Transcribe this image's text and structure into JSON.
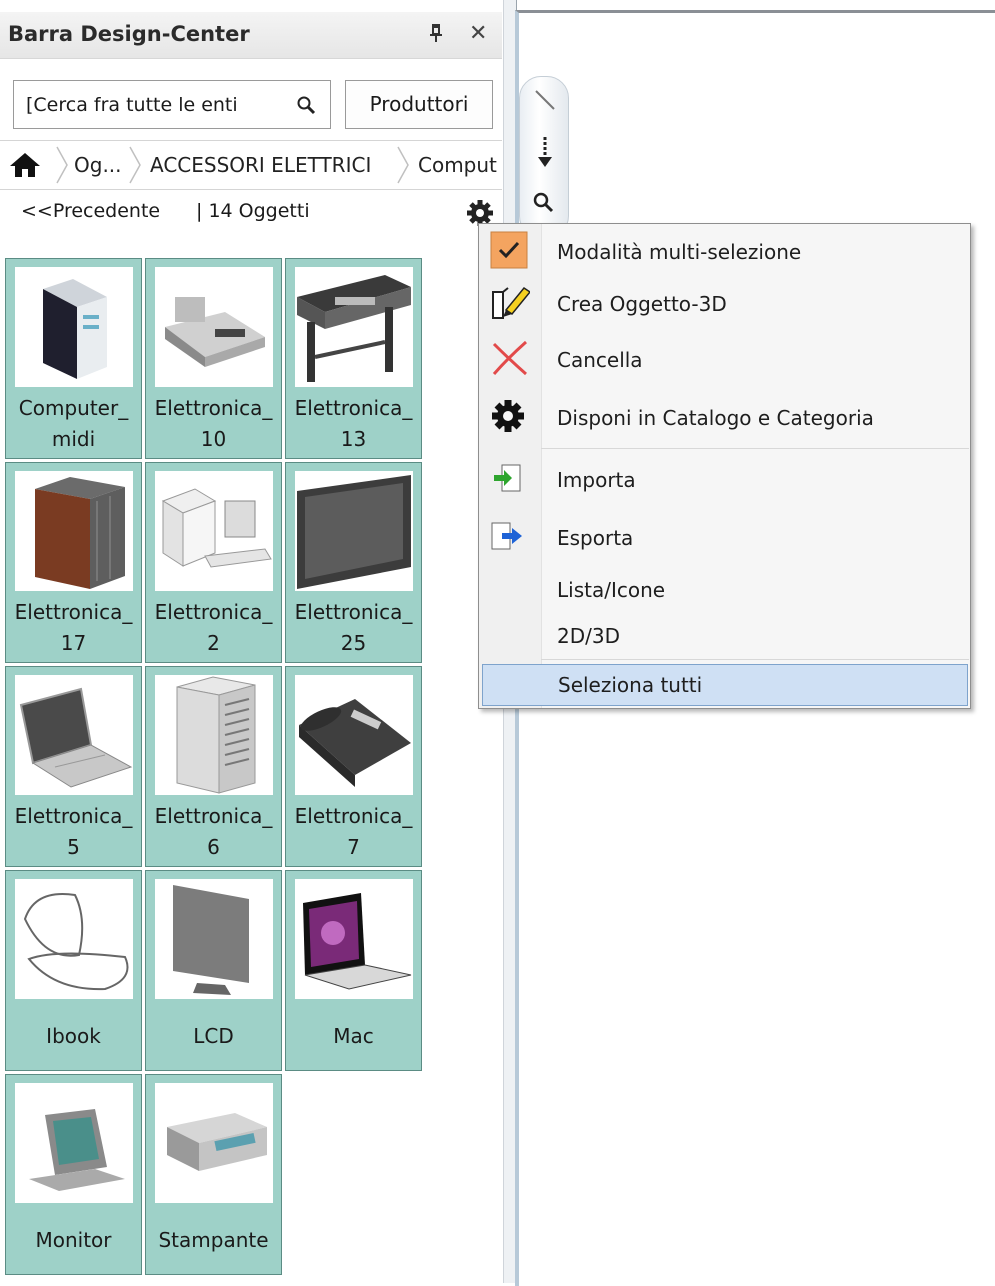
{
  "panel": {
    "title": "Barra Design-Center",
    "pin_icon": "pin-icon",
    "close_icon": "close-icon",
    "search": {
      "value": "[Cerca fra tutte le enti",
      "icon": "search-icon"
    },
    "produttori_label": "Produttori",
    "breadcrumb": [
      "Og...",
      "ACCESSORI ELETTRICI",
      "Comput"
    ],
    "nav": {
      "prev_label": "<<Precedente",
      "count_label": "| 14 Oggetti"
    },
    "tiles": [
      {
        "name": "Computer_\nmidi",
        "icon": "desktop-tower-icon"
      },
      {
        "name": "Elettronica_\n10",
        "icon": "fax-machine-icon"
      },
      {
        "name": "Elettronica_\n13",
        "icon": "plotter-icon"
      },
      {
        "name": "Elettronica_\n17",
        "icon": "speaker-cabinet-icon"
      },
      {
        "name": "Elettronica_\n2",
        "icon": "mac-pro-icon"
      },
      {
        "name": "Elettronica_\n25",
        "icon": "flat-screen-icon"
      },
      {
        "name": "Elettronica_\n5",
        "icon": "laptop-icon"
      },
      {
        "name": "Elettronica_\n6",
        "icon": "server-rack-icon"
      },
      {
        "name": "Elettronica_\n7",
        "icon": "desk-phone-icon"
      },
      {
        "name": "Ibook",
        "icon": "ibook-icon"
      },
      {
        "name": "LCD",
        "icon": "lcd-monitor-icon"
      },
      {
        "name": "Mac",
        "icon": "macbook-icon"
      },
      {
        "name": "Monitor",
        "icon": "crt-monitor-icon"
      },
      {
        "name": "Stampante",
        "icon": "printer-icon"
      }
    ]
  },
  "menu": {
    "items": [
      {
        "label": "Modalità multi-selezione",
        "icon": "checkmark-icon",
        "checked": true
      },
      {
        "label": "Crea Oggetto-3D",
        "icon": "pencil-object-icon"
      },
      {
        "label": "Cancella",
        "icon": "delete-x-icon"
      },
      {
        "label": "Disponi in Catalogo e Categoria",
        "icon": "gear-icon"
      },
      {
        "label": "Importa",
        "icon": "import-icon"
      },
      {
        "label": "Esporta",
        "icon": "export-icon"
      },
      {
        "label": "Lista/Icone",
        "icon": ""
      },
      {
        "label": "2D/3D",
        "icon": ""
      },
      {
        "label": "Seleziona tutti",
        "icon": "",
        "highlighted": true
      }
    ]
  },
  "colors": {
    "tile_bg": "#9ed1c8",
    "menu_highlight": "#cfe0f4",
    "check_bg": "#f4a460"
  }
}
